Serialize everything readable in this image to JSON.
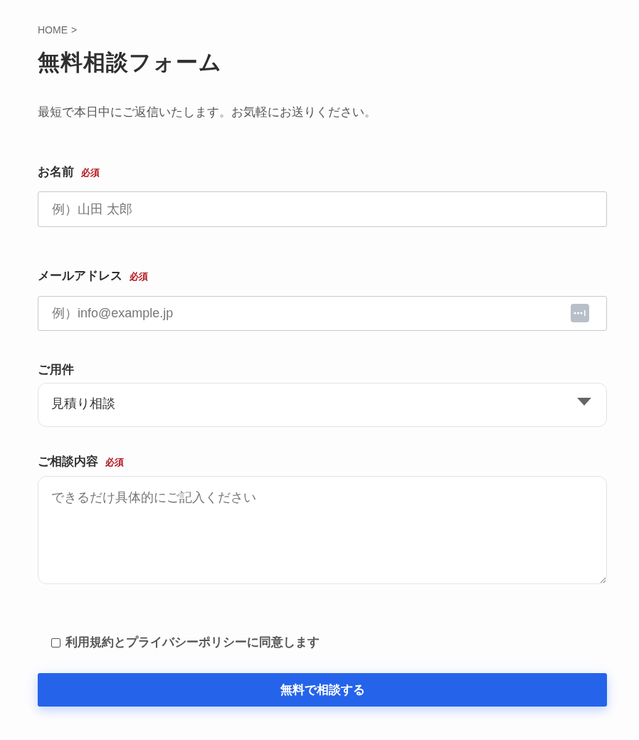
{
  "breadcrumb": {
    "items": [
      "HOME"
    ],
    "separator": ">"
  },
  "title": "無料相談フォーム",
  "lead": "最短で本日中にご返信いたします。お気軽にお送りください。",
  "fields": [
    {
      "kind": "text",
      "label": "お名前",
      "required_mark": "必須",
      "placeholder": "例）山田 太郎"
    },
    {
      "kind": "email",
      "label": "メールアドレス",
      "required_mark": "必須",
      "placeholder": "例）info@example.jp"
    },
    {
      "kind": "select",
      "label": "ご用件",
      "value": "見積り相談"
    },
    {
      "kind": "textarea",
      "label": "ご相談内容",
      "required_mark": "必須",
      "placeholder": "できるだけ具体的にご記入ください"
    }
  ],
  "consent": {
    "label": "利用規約とプライバシーポリシーに同意します",
    "checked": false
  },
  "submit": {
    "label": "無料で相談する"
  }
}
